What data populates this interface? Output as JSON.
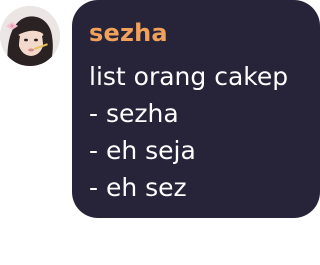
{
  "message": {
    "author": "sezha",
    "lines": [
      "list orang cakep",
      "- sezha",
      "- eh seja",
      "- eh sez"
    ],
    "author_color": "#f0a25c",
    "bubble_color": "#27243a"
  },
  "avatar": {
    "icon": "user-avatar-photo"
  }
}
